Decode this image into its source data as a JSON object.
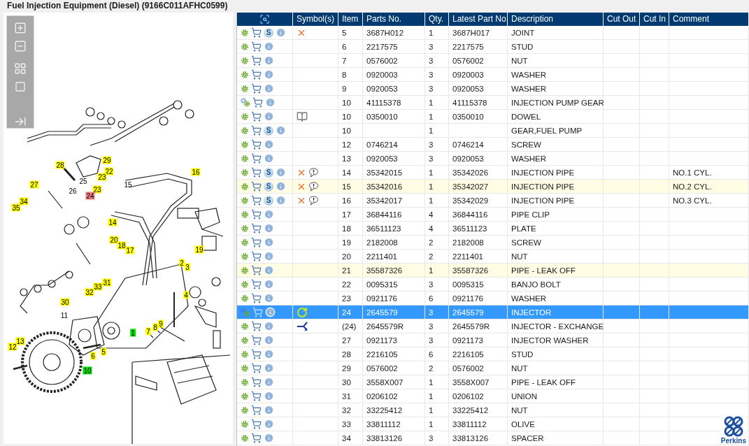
{
  "title": "Fuel Injection Equipment (Diesel) (9166C011AFHC0599)",
  "diagram": {
    "callouts": [
      {
        "label": "28",
        "kind": "tag",
        "color": "#ffff00"
      },
      {
        "label": "29",
        "kind": "tag",
        "color": "#ffff00"
      },
      {
        "label": "22",
        "kind": "tag",
        "color": "#ffff00"
      },
      {
        "label": "23",
        "kind": "tag",
        "color": "#ffff00"
      },
      {
        "label": "16",
        "kind": "tag",
        "color": "#ffff00"
      },
      {
        "label": "27",
        "kind": "tag",
        "color": "#ffff00"
      },
      {
        "label": "25",
        "kind": "plain"
      },
      {
        "label": "26",
        "kind": "plain"
      },
      {
        "label": "15",
        "kind": "plain"
      },
      {
        "label": "23",
        "kind": "tag",
        "color": "#ffff00"
      },
      {
        "label": "24",
        "kind": "tag",
        "color": "#f08080"
      },
      {
        "label": "34",
        "kind": "tag",
        "color": "#ffff00"
      },
      {
        "label": "35",
        "kind": "tag",
        "color": "#ffff00"
      },
      {
        "label": "14",
        "kind": "tag",
        "color": "#ffff00"
      },
      {
        "label": "20",
        "kind": "tag",
        "color": "#ffff00"
      },
      {
        "label": "18",
        "kind": "tag",
        "color": "#ffff00"
      },
      {
        "label": "17",
        "kind": "tag",
        "color": "#ffff00"
      },
      {
        "label": "19",
        "kind": "tag",
        "color": "#ffff00"
      },
      {
        "label": "2",
        "kind": "tag",
        "color": "#ffff00"
      },
      {
        "label": "3",
        "kind": "tag",
        "color": "#ffff00"
      },
      {
        "label": "31",
        "kind": "tag",
        "color": "#ffff00"
      },
      {
        "label": "33",
        "kind": "tag",
        "color": "#ffff00"
      },
      {
        "label": "32",
        "kind": "tag",
        "color": "#ffff00"
      },
      {
        "label": "4",
        "kind": "tag",
        "color": "#ffff00"
      },
      {
        "label": "30",
        "kind": "tag",
        "color": "#ffff00"
      },
      {
        "label": "11",
        "kind": "plain"
      },
      {
        "label": "1",
        "kind": "tag",
        "color": "#00e000"
      },
      {
        "label": "7",
        "kind": "tag",
        "color": "#ffff00"
      },
      {
        "label": "8",
        "kind": "tag",
        "color": "#ffff00"
      },
      {
        "label": "9",
        "kind": "tag",
        "color": "#ffff00"
      },
      {
        "label": "13",
        "kind": "tag",
        "color": "#ffff00"
      },
      {
        "label": "12",
        "kind": "tag",
        "color": "#ffff00"
      },
      {
        "label": "5",
        "kind": "tag",
        "color": "#ffff00"
      },
      {
        "label": "6",
        "kind": "tag",
        "color": "#ffff00"
      },
      {
        "label": "10",
        "kind": "tag",
        "color": "#00e000"
      }
    ]
  },
  "table": {
    "columns": [
      "Symbol(s)",
      "Item",
      "Parts No.",
      "Qty.",
      "Latest Part No.",
      "Description",
      "Cut Out",
      "Cut In",
      "Comment"
    ],
    "rows": [
      {
        "item": "5",
        "part_no": "3687H012",
        "qty": "1",
        "latest_part_no": "3687H017",
        "description": "JOINT",
        "kind": "part",
        "service_mark": "S",
        "symbols": [
          {
            "kind": "cross"
          }
        ],
        "highlighted": false,
        "selected": false
      },
      {
        "item": "6",
        "part_no": "2217575",
        "qty": "3",
        "latest_part_no": "2217575",
        "description": "STUD",
        "kind": "part",
        "highlighted": false,
        "selected": false
      },
      {
        "item": "7",
        "part_no": "0576002",
        "qty": "3",
        "latest_part_no": "0576002",
        "description": "NUT",
        "kind": "part",
        "highlighted": false,
        "selected": false
      },
      {
        "item": "8",
        "part_no": "0920003",
        "qty": "3",
        "latest_part_no": "0920003",
        "description": "WASHER",
        "kind": "part",
        "highlighted": false,
        "selected": false
      },
      {
        "item": "9",
        "part_no": "0920053",
        "qty": "3",
        "latest_part_no": "0920053",
        "description": "WASHER",
        "kind": "part",
        "highlighted": false,
        "selected": false
      },
      {
        "item": "10",
        "part_no": "41115378",
        "qty": "1",
        "latest_part_no": "41115378",
        "description": "INJECTION PUMP GEAR",
        "kind": "assembly",
        "highlighted": false,
        "selected": false
      },
      {
        "item": "10",
        "part_no": "0350010",
        "qty": "1",
        "latest_part_no": "0350010",
        "description": "DOWEL",
        "kind": "part",
        "symbols": [
          {
            "kind": "book"
          }
        ],
        "highlighted": false,
        "selected": false
      },
      {
        "item": "10",
        "qty": "1",
        "description": "GEAR,FUEL PUMP",
        "kind": "part",
        "service_mark": "S",
        "highlighted": false,
        "selected": false
      },
      {
        "item": "12",
        "part_no": "0746214",
        "qty": "3",
        "latest_part_no": "0746214",
        "description": "SCREW",
        "kind": "part",
        "highlighted": false,
        "selected": false
      },
      {
        "item": "13",
        "part_no": "0920053",
        "qty": "3",
        "latest_part_no": "0920053",
        "description": "WASHER",
        "kind": "part",
        "highlighted": false,
        "selected": false
      },
      {
        "item": "14",
        "part_no": "35342015",
        "qty": "1",
        "latest_part_no": "35342026",
        "description": "INJECTION PIPE",
        "comment": "NO.1 CYL.",
        "kind": "part",
        "service_mark": "S",
        "symbols": [
          {
            "kind": "cross"
          },
          {
            "kind": "note"
          }
        ],
        "highlighted": false,
        "selected": false
      },
      {
        "item": "15",
        "part_no": "35342016",
        "qty": "1",
        "latest_part_no": "35342027",
        "description": "INJECTION PIPE",
        "comment": "NO.2 CYL.",
        "kind": "part",
        "service_mark": "S",
        "symbols": [
          {
            "kind": "cross"
          },
          {
            "kind": "note"
          }
        ],
        "highlighted": true,
        "selected": false
      },
      {
        "item": "16",
        "part_no": "35342017",
        "qty": "1",
        "latest_part_no": "35342029",
        "description": "INJECTION PIPE",
        "comment": "NO.3 CYL.",
        "kind": "part",
        "service_mark": "S",
        "symbols": [
          {
            "kind": "cross"
          },
          {
            "kind": "note"
          }
        ],
        "highlighted": false,
        "selected": false
      },
      {
        "item": "17",
        "part_no": "36844116",
        "qty": "4",
        "latest_part_no": "36844116",
        "description": "PIPE CLIP",
        "kind": "part",
        "highlighted": false,
        "selected": false
      },
      {
        "item": "18",
        "part_no": "36511123",
        "qty": "4",
        "latest_part_no": "36511123",
        "description": "PLATE",
        "kind": "part",
        "highlighted": false,
        "selected": false
      },
      {
        "item": "19",
        "part_no": "2182008",
        "qty": "2",
        "latest_part_no": "2182008",
        "description": "SCREW",
        "kind": "part",
        "highlighted": false,
        "selected": false
      },
      {
        "item": "20",
        "part_no": "2211401",
        "qty": "2",
        "latest_part_no": "2211401",
        "description": "NUT",
        "kind": "part",
        "highlighted": false,
        "selected": false
      },
      {
        "item": "21",
        "part_no": "35587326",
        "qty": "1",
        "latest_part_no": "35587326",
        "description": "PIPE - LEAK OFF",
        "kind": "part",
        "highlighted": true,
        "selected": false
      },
      {
        "item": "22",
        "part_no": "0095315",
        "qty": "3",
        "latest_part_no": "0095315",
        "description": "BANJO BOLT",
        "kind": "part",
        "highlighted": false,
        "selected": false
      },
      {
        "item": "23",
        "part_no": "0921176",
        "qty": "6",
        "latest_part_no": "0921176",
        "description": "WASHER",
        "kind": "part",
        "highlighted": false,
        "selected": false
      },
      {
        "item": "24",
        "part_no": "2645579",
        "qty": "3",
        "latest_part_no": "2645579",
        "description": "INJECTOR",
        "kind": "assembly",
        "symbols": [
          {
            "kind": "refresh"
          }
        ],
        "highlighted": false,
        "selected": true
      },
      {
        "item": "(24)",
        "part_no": "2645579R",
        "qty": "3",
        "latest_part_no": "2645579R",
        "description": "INJECTOR - EXCHANGE",
        "kind": "part",
        "symbols": [
          {
            "kind": "exchange"
          }
        ],
        "highlighted": false,
        "selected": false
      },
      {
        "item": "27",
        "part_no": "0921173",
        "qty": "3",
        "latest_part_no": "0921173",
        "description": "INJECTOR WASHER",
        "kind": "part",
        "highlighted": false,
        "selected": false
      },
      {
        "item": "28",
        "part_no": "2216105",
        "qty": "6",
        "latest_part_no": "2216105",
        "description": "STUD",
        "kind": "part",
        "highlighted": false,
        "selected": false
      },
      {
        "item": "29",
        "part_no": "0576002",
        "qty": "2",
        "latest_part_no": "0576002",
        "description": "NUT",
        "kind": "part",
        "highlighted": false,
        "selected": false
      },
      {
        "item": "30",
        "part_no": "3558X007",
        "qty": "1",
        "latest_part_no": "3558X007",
        "description": "PIPE - LEAK OFF",
        "kind": "part",
        "highlighted": false,
        "selected": false
      },
      {
        "item": "31",
        "part_no": "0206102",
        "qty": "1",
        "latest_part_no": "0206102",
        "description": "UNION",
        "kind": "part",
        "highlighted": false,
        "selected": false
      },
      {
        "item": "32",
        "part_no": "33225412",
        "qty": "1",
        "latest_part_no": "33225412",
        "description": "NUT",
        "kind": "part",
        "highlighted": false,
        "selected": false
      },
      {
        "item": "33",
        "part_no": "33811112",
        "qty": "1",
        "latest_part_no": "33811112",
        "description": "OLIVE",
        "kind": "part",
        "highlighted": false,
        "selected": false
      },
      {
        "item": "34",
        "part_no": "33813126",
        "qty": "3",
        "latest_part_no": "33813126",
        "description": "SPACER",
        "kind": "part",
        "highlighted": false,
        "selected": false
      }
    ]
  },
  "logo": {
    "text": "Perkins"
  }
}
